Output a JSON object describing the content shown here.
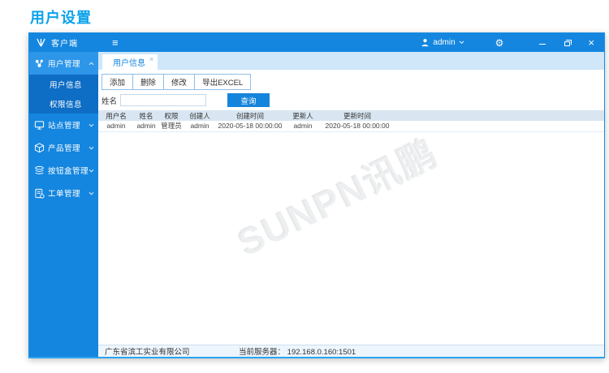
{
  "page": {
    "title": "用户设置"
  },
  "titlebar": {
    "app_title": "客户端",
    "user": "admin"
  },
  "sidebar": {
    "items": [
      {
        "label": "用户管理",
        "icon": "users-group-icon",
        "expanded": true,
        "selected": true,
        "children": [
          {
            "label": "用户信息",
            "selected": true
          },
          {
            "label": "权限信息",
            "selected": false
          }
        ]
      },
      {
        "label": "站点管理",
        "icon": "monitor-icon",
        "expanded": false
      },
      {
        "label": "产品管理",
        "icon": "cube-icon",
        "expanded": false
      },
      {
        "label": "按钮盒管理",
        "icon": "layers-icon",
        "expanded": false
      },
      {
        "label": "工单管理",
        "icon": "work-order-icon",
        "expanded": false
      }
    ]
  },
  "tabs": [
    {
      "label": "用户信息",
      "active": true,
      "closable": true
    }
  ],
  "toolbar": {
    "buttons": [
      {
        "label": "添加"
      },
      {
        "label": "删除"
      },
      {
        "label": "修改"
      },
      {
        "label": "导出EXCEL"
      }
    ]
  },
  "search": {
    "label": "姓名",
    "value": "",
    "button": "查询"
  },
  "table": {
    "columns": [
      "用户名",
      "姓名",
      "权限",
      "创建人",
      "创建时间",
      "更新人",
      "更新时间"
    ],
    "rows": [
      [
        "admin",
        "admin",
        "管理员",
        "admin",
        "2020-05-18 00:00:00",
        "admin",
        "2020-05-18 00:00:00"
      ]
    ]
  },
  "watermark": "SUNPN讯鹏",
  "statusbar": {
    "company": "广东省滨工实业有限公司",
    "server_label": "当前服务器： ",
    "server_value": "192.168.0.160:1501"
  },
  "colors": {
    "accent": "#1584dc",
    "titlebar": "#1486df",
    "sidebar_selected": "#2d96e9",
    "submenu": "#0e6dc4",
    "tabstrip_bg": "#cfe7f9",
    "table_header_bg": "#d9e6f2",
    "heading": "#0ba3eb"
  }
}
